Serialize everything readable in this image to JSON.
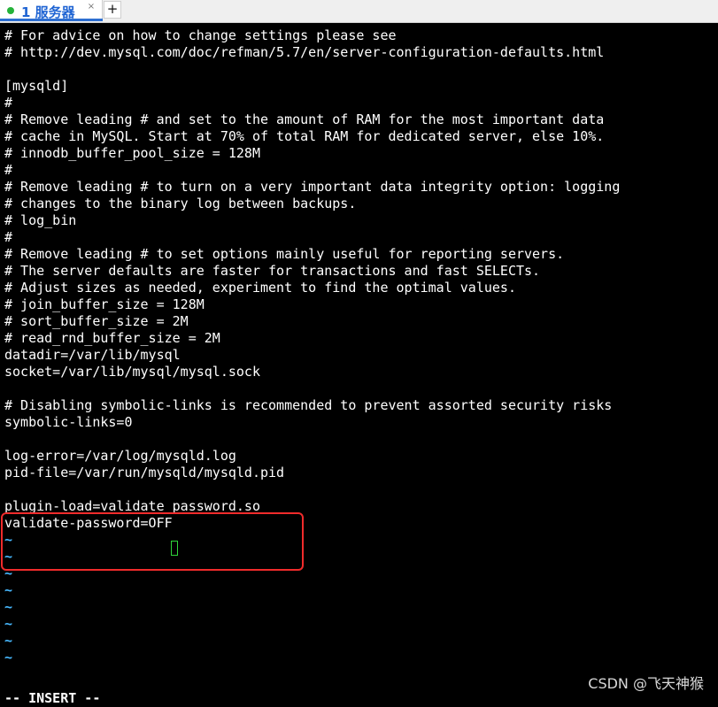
{
  "tab": {
    "label": "1 服务器",
    "close_label": "×",
    "add_label": "+"
  },
  "terminal": {
    "lines": [
      "# For advice on how to change settings please see",
      "# http://dev.mysql.com/doc/refman/5.7/en/server-configuration-defaults.html",
      "",
      "[mysqld]",
      "#",
      "# Remove leading # and set to the amount of RAM for the most important data",
      "# cache in MySQL. Start at 70% of total RAM for dedicated server, else 10%.",
      "# innodb_buffer_pool_size = 128M",
      "#",
      "# Remove leading # to turn on a very important data integrity option: logging",
      "# changes to the binary log between backups.",
      "# log_bin",
      "#",
      "# Remove leading # to set options mainly useful for reporting servers.",
      "# The server defaults are faster for transactions and fast SELECTs.",
      "# Adjust sizes as needed, experiment to find the optimal values.",
      "# join_buffer_size = 128M",
      "# sort_buffer_size = 2M",
      "# read_rnd_buffer_size = 2M",
      "datadir=/var/lib/mysql",
      "socket=/var/lib/mysql/mysql.sock",
      "",
      "# Disabling symbolic-links is recommended to prevent assorted security risks",
      "symbolic-links=0",
      "",
      "log-error=/var/log/mysqld.log",
      "pid-file=/var/run/mysqld/mysqld.pid",
      "",
      "plugin-load=validate_password.so",
      "validate-password=OFF"
    ],
    "tildes": [
      "~",
      "~",
      "~",
      "~",
      "~",
      "~",
      "~",
      "~"
    ],
    "mode": "-- INSERT --"
  },
  "watermark": "CSDN @飞天神猴",
  "colors": {
    "background": "#000000",
    "text": "#ffffff",
    "tilde": "#47b9ff",
    "cursor": "#2fd43a",
    "highlight": "#f02b2b",
    "tab_active": "#1f64d3"
  },
  "icons": {
    "status": "session-status-dot-icon",
    "close": "close-icon",
    "add": "add-tab-icon"
  }
}
